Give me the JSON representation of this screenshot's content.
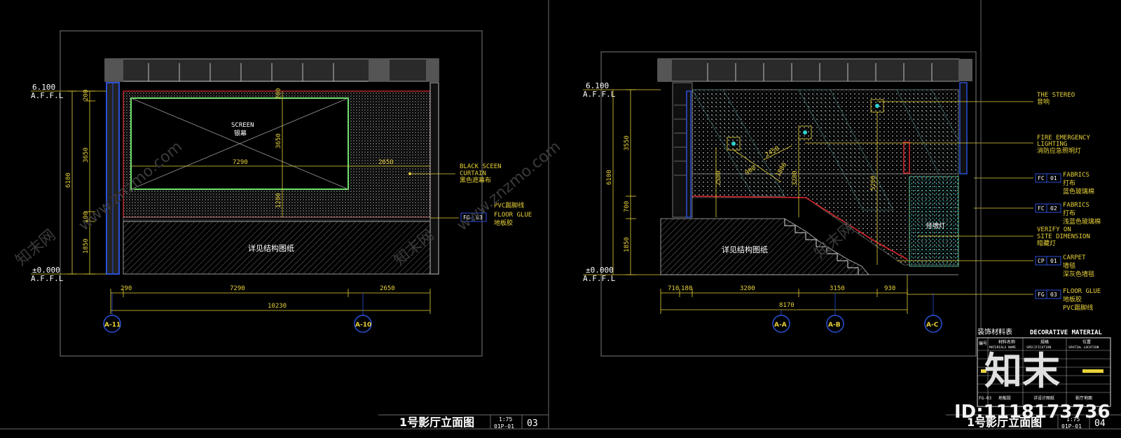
{
  "left_sheet": {
    "level_top": "6.100",
    "level_top_affl": "A.F.F.L",
    "level_bottom": "±0.000",
    "level_bottom_affl": "A.F.F.L",
    "screen_en": "SCREEN",
    "screen_cn": "银幕",
    "screen_width": "7290",
    "screen_height": "3650",
    "wall_offset": "2650",
    "screen_bottom": "1200",
    "dim_v_200": "200",
    "dim_v_3650": "3650",
    "dim_v_6100": "6100",
    "dim_v_100": "100",
    "dim_v_1850": "1850",
    "structure_note": "详见结构图纸",
    "label_curtain_en1": "BLACK SCEEN",
    "label_curtain_en2": "CURTAIN",
    "label_curtain_cn": "黑色遮幕布",
    "label_pvc": "PVC踢脚线",
    "label_floor_tag": "FG",
    "label_floor_num": "03",
    "label_floor_en": "FLOOR GLUE",
    "label_floor_cn": "地板胶",
    "dim_b_290": "290",
    "dim_b_7290": "7290",
    "dim_b_2650": "2650",
    "dim_b_total": "10230",
    "grid_1": "A-11",
    "grid_2": "A-10",
    "title": "1号影厅立面图",
    "scale": "1:75",
    "code": "01P-01",
    "sheet_no": "03"
  },
  "right_sheet": {
    "level_top": "6.100",
    "level_top_affl": "A.F.F.L",
    "level_bottom": "±0.000",
    "level_bottom_affl": "A.F.F.L",
    "dim_v_3550": "3550",
    "dim_v_6100": "6100",
    "dim_v_700": "700",
    "dim_v_1850": "1850",
    "dim_i_2500": "2500",
    "dim_i_900": "900",
    "dim_i_1800": "1800",
    "dim_i_2450": "2450",
    "dim_i_3200": "3200",
    "dim_i_5200": "5200",
    "structure_note": "详见结构图纸",
    "hidden_light": "挂墙灯",
    "label_stereo_en": "THE STEREO",
    "label_stereo_cn": "音响",
    "label_fire_en1": "FIRE EMERGENCY",
    "label_fire_en2": "LIGHTING",
    "label_fire_cn": "消防应急照明灯",
    "label_fc1_tag": "FC",
    "label_fc1_num": "01",
    "label_fc1_en": "FABRICS",
    "label_fc1_cn1": "打布",
    "label_fc1_cn2": "蓝色玻璃棉",
    "label_fc2_tag": "FC",
    "label_fc2_num": "02",
    "label_fc2_en": "FABRICS",
    "label_fc2_cn1": "打布",
    "label_fc2_cn2": "浅蓝色玻璃棉",
    "label_verify_en1": "VERIFY ON",
    "label_verify_en2": "SITE DIMENSION",
    "label_verify_cn": "暗藏灯",
    "label_cp_tag": "CP",
    "label_cp_num": "01",
    "label_cp_en": "CARPET",
    "label_cp_cn1": "墙毯",
    "label_cp_cn2": "深灰色墙毯",
    "label_fg_tag": "FG",
    "label_fg_num": "03",
    "label_fg_en": "FLOOR GLUE",
    "label_fg_cn1": "地板胶",
    "label_fg_cn2": "PVC踢脚线",
    "dim_b_710": "710",
    "dim_b_180": "180",
    "dim_b_3200": "3200",
    "dim_b_3150": "3150",
    "dim_b_930": "930",
    "dim_b_total": "8170",
    "grid_1": "A-A",
    "grid_2": "A-B",
    "grid_3": "A-C",
    "title": "1号影厅立面图",
    "scale": "1:75",
    "code": "01P-01",
    "sheet_no": "04"
  },
  "material_table": {
    "title_cn": "装饰材料表",
    "title_en": "DECORATIVE MATERIAL",
    "col1_cn": "编号",
    "col2_cn": "材料名称",
    "col2_en": "MATERIALS NAME",
    "col3_cn": "规格",
    "col3_en": "SPECIFICATION",
    "col4_cn": "位置",
    "col4_en": "SPATIAL LOCATION",
    "last_row_code": "FG-03",
    "last_row_name": "地板胶",
    "last_row_spec": "详设计图纸",
    "last_row_loc": "影厅地面"
  },
  "watermark": {
    "site": "www.znzmo.com",
    "brand_cn": "知末网",
    "logo_text": "知末",
    "id_text": "ID:1118173736"
  },
  "colors": {
    "cad_yellow": "#e8d23a",
    "cad_cyan": "#2fd3d0",
    "cad_red": "#d8262c",
    "cad_blue": "#2b50d8",
    "cad_green": "#6fe06a"
  }
}
